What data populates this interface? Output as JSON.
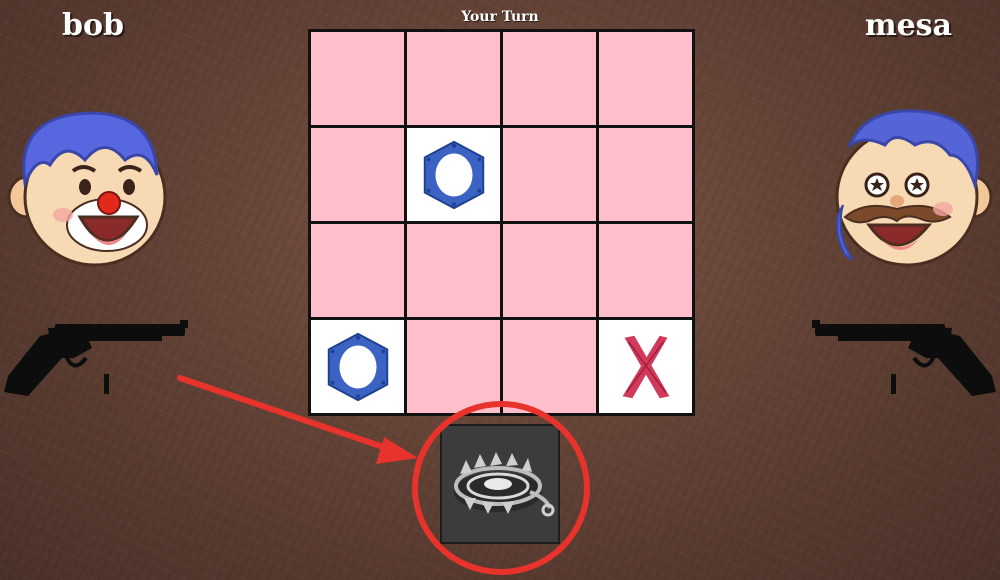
{
  "players": {
    "left": {
      "name": "bob",
      "avatar": "clown-face-icon",
      "weapon": "revolver-icon"
    },
    "right": {
      "name": "mesa",
      "avatar": "mustache-face-icon",
      "weapon": "revolver-icon"
    }
  },
  "status": {
    "turn_text": "Your Turn"
  },
  "board": {
    "size": 4,
    "cells": [
      [
        "",
        "",
        "",
        ""
      ],
      [
        "",
        "O",
        "",
        ""
      ],
      [
        "",
        "",
        "",
        ""
      ],
      [
        "O",
        "",
        "",
        "X"
      ]
    ]
  },
  "item": {
    "icon": "bear-trap-icon"
  },
  "annotation": {
    "color": "#e8322c",
    "shape": "arrow-and-circle"
  },
  "colors": {
    "cell_empty": "#ffc0cb",
    "cell_filled": "#ffffff",
    "o_mark": "#3b63c4",
    "x_mark": "#d23a5c",
    "background": "#5e3f33"
  }
}
